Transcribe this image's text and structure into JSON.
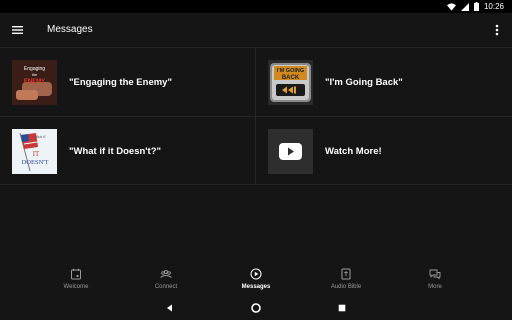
{
  "status": {
    "time": "10:26",
    "icons": [
      "wifi-icon",
      "signal-icon",
      "battery-icon"
    ]
  },
  "appbar": {
    "title": "Messages"
  },
  "messages": [
    {
      "title": "\"Engaging the Enemy\"",
      "thumb_text_1": "Engaging",
      "thumb_text_2": "the",
      "thumb_text_3": "ENEMY"
    },
    {
      "title": "\"I'm Going Back\"",
      "thumb_text_1": "I'M GOING",
      "thumb_text_2": "BACK"
    },
    {
      "title": "\"What if it Doesn't?\"",
      "thumb_text_1": "what if",
      "thumb_text_2": "IT",
      "thumb_text_3": "DOESN'T"
    },
    {
      "title": "Watch More!"
    }
  ],
  "nav": {
    "items": [
      {
        "label": "Welcome",
        "icon": "calendar-icon"
      },
      {
        "label": "Connect",
        "icon": "people-icon"
      },
      {
        "label": "Messages",
        "icon": "play-circle-icon",
        "active": true
      },
      {
        "label": "Audio Bible",
        "icon": "bible-icon"
      },
      {
        "label": "More",
        "icon": "chat-icon"
      }
    ]
  },
  "colors": {
    "background": "#151515",
    "divider": "#262626",
    "inactive": "#9a9a9a",
    "youtube_red": "#ffffff"
  }
}
